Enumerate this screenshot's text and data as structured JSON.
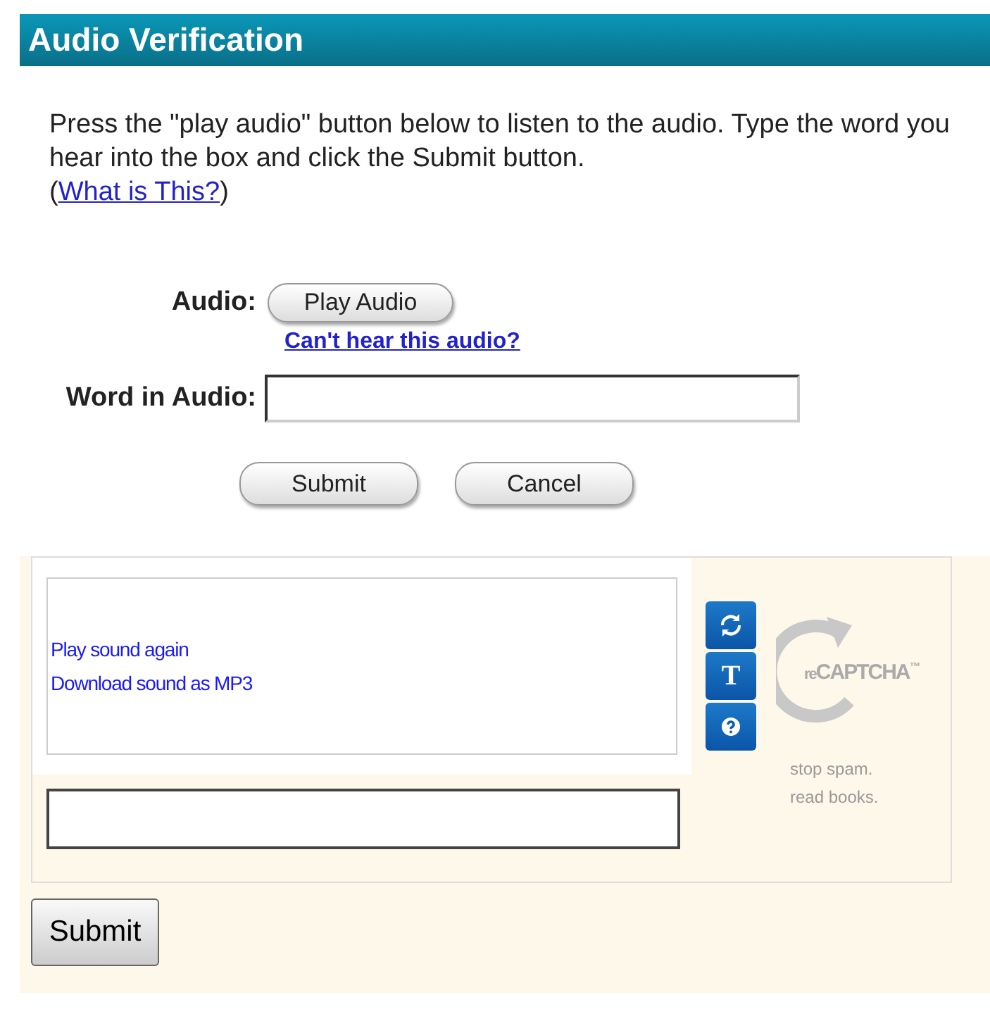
{
  "header": {
    "title": "Audio Verification"
  },
  "instructions": {
    "text": "Press the \"play audio\" button below to listen to the audio. Type the word you hear into the box and click the Submit button.",
    "open_paren": "(",
    "link": "What is This?",
    "close_paren": ")"
  },
  "audio_row": {
    "label": "Audio:",
    "button": "Play Audio",
    "help_link": "Can't hear this audio?"
  },
  "word_row": {
    "label": "Word in Audio:"
  },
  "buttons": [
    {
      "label": "Submit"
    },
    {
      "label": "Cancel"
    }
  ],
  "recaptcha": {
    "links": [
      "Play sound again",
      "Download sound as MP3"
    ],
    "tools": [
      {
        "kind": "reload"
      },
      {
        "kind": "text",
        "glyph": "T"
      },
      {
        "kind": "help"
      }
    ],
    "logo": {
      "prefix": "re",
      "name": "CAPTCHA",
      "mark": "™"
    },
    "slogan": [
      "stop spam.",
      "read books."
    ],
    "submit": "Submit"
  }
}
